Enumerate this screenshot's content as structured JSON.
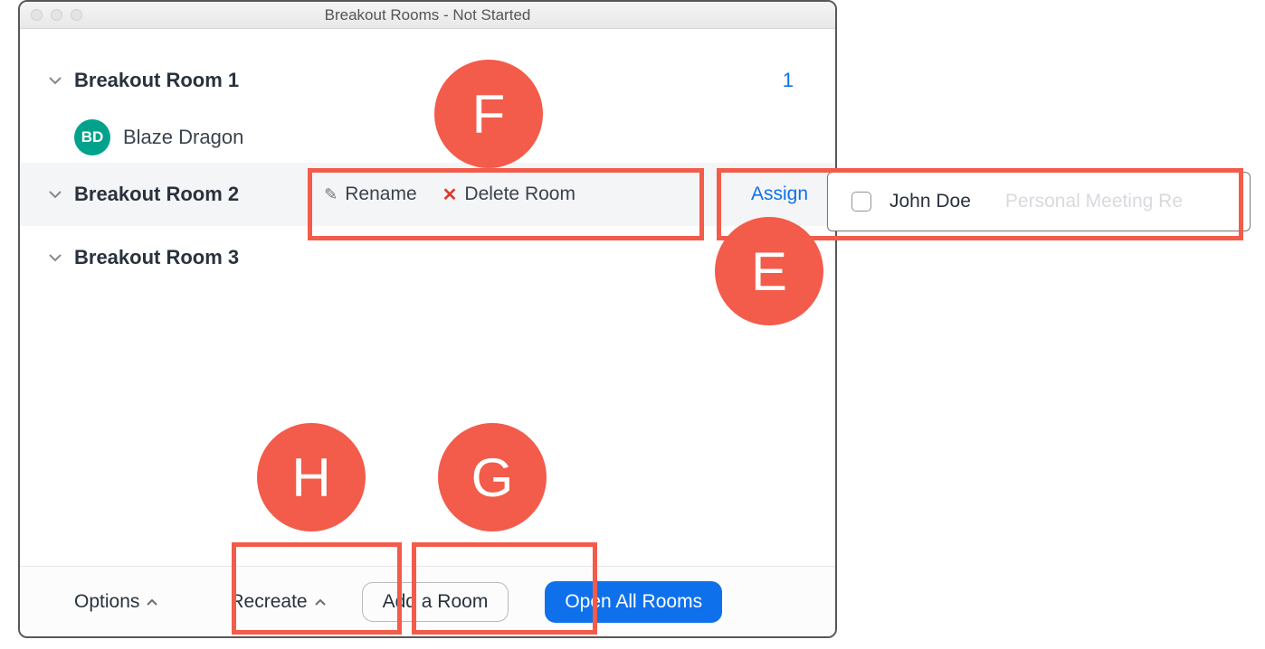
{
  "window": {
    "title": "Breakout Rooms - Not Started"
  },
  "rooms": [
    {
      "name": "Breakout Room 1",
      "count": "1",
      "participants": [
        {
          "initials": "BD",
          "name": "Blaze  Dragon"
        }
      ]
    },
    {
      "name": "Breakout Room 2",
      "active": true
    },
    {
      "name": "Breakout Room 3"
    }
  ],
  "row_actions": {
    "rename": "Rename",
    "delete": "Delete Room",
    "assign": "Assign"
  },
  "assign_popover": {
    "name": "John Doe",
    "secondary": "Personal Meeting Re"
  },
  "footer": {
    "options": "Options",
    "recreate": "Recreate",
    "add_room": "Add a Room",
    "open_all": "Open All Rooms"
  },
  "annotations": {
    "F": "F",
    "E": "E",
    "H": "H",
    "G": "G"
  }
}
